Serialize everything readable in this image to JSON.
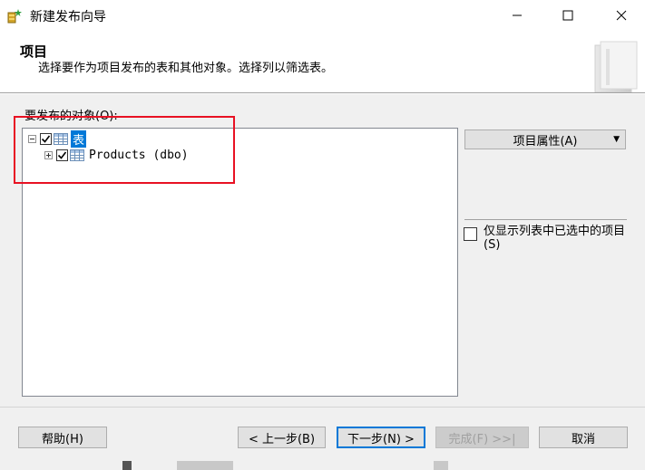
{
  "window": {
    "title": "新建发布向导",
    "minimize_glyph": "—",
    "maximize_glyph": "☐",
    "close_glyph": "✕"
  },
  "header": {
    "title": "项目",
    "subtitle": "选择要作为项目发布的表和其他对象。选择列以筛选表。"
  },
  "objects": {
    "label": "要发布的对象(O):",
    "tree": {
      "root": {
        "label": "表",
        "checked": true,
        "expanded": true,
        "icon": "table-icon"
      },
      "children": [
        {
          "label": "Products (dbo)",
          "checked": true,
          "expanded": false,
          "icon": "table-icon"
        }
      ]
    }
  },
  "side": {
    "article_properties": "项目属性(A)",
    "dropdown_glyph": "▼",
    "filter_checkbox_label": "仅显示列表中已选中的项目(S)",
    "filter_checked": false
  },
  "buttons": {
    "help": "帮助(H)",
    "back": "< 上一步(B)",
    "next": "下一步(N) >",
    "finish": "完成(F) >>|",
    "cancel": "取消"
  },
  "colors": {
    "accent": "#0078d7",
    "highlight_annotation": "#e81123",
    "dialog_bg": "#f0f0f0"
  }
}
